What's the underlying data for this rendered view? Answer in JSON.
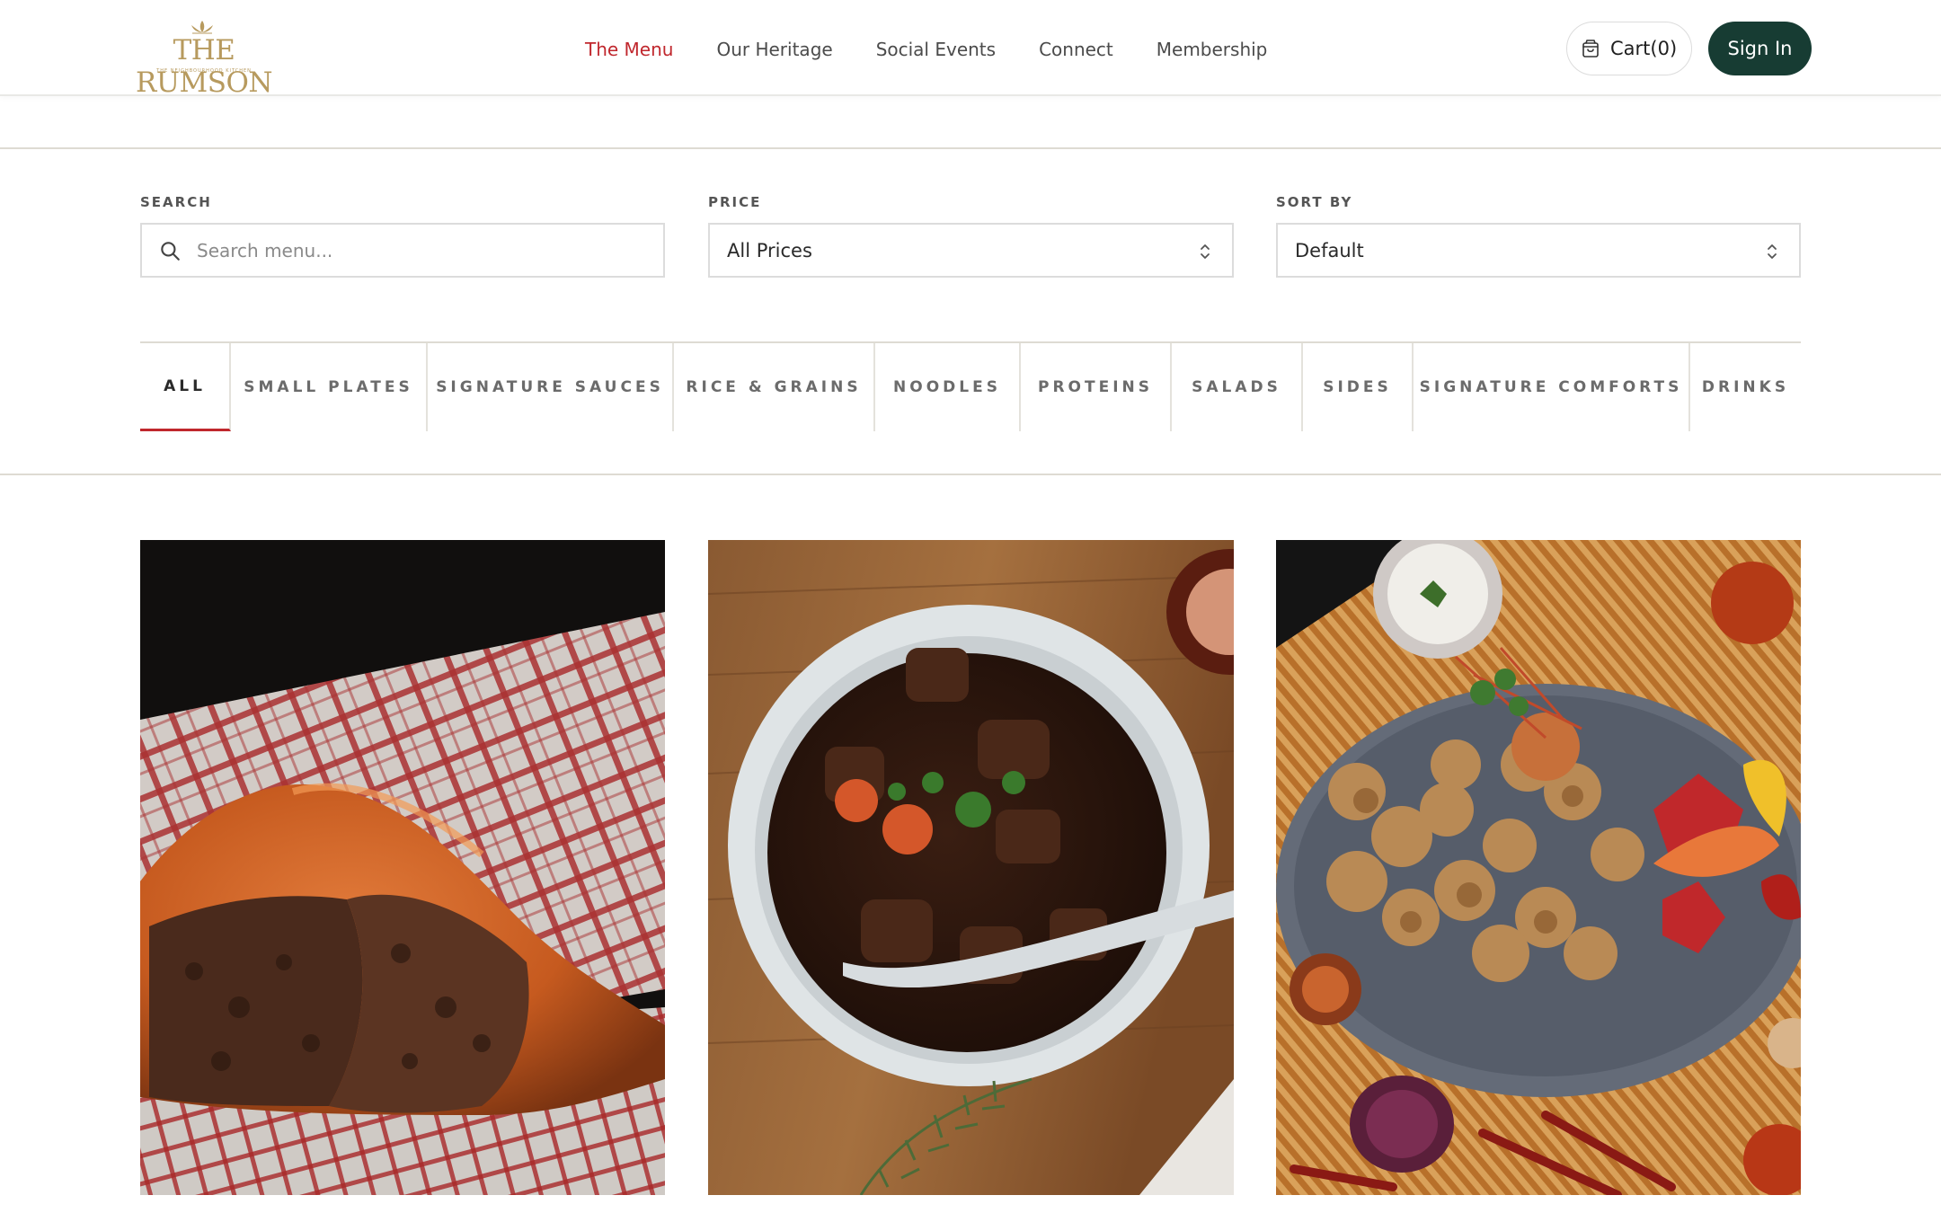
{
  "brand": {
    "name": "THE RUMSON",
    "tagline": "THE NEIGHBOURHOOD KITCHEN",
    "color": "#b79a5e"
  },
  "nav": {
    "items": [
      "The Menu",
      "Our Heritage",
      "Social Events",
      "Connect",
      "Membership"
    ],
    "active_index": 0,
    "active_color": "#c0272d"
  },
  "header": {
    "cart_label": "Cart(0)",
    "cart_icon": "shopping-bag-icon",
    "signin_label": "Sign In",
    "signin_bg": "#173c33"
  },
  "filters": {
    "search": {
      "label": "SEARCH",
      "placeholder": "Search menu...",
      "value": "",
      "icon": "search-icon"
    },
    "price": {
      "label": "PRICE",
      "selected": "All Prices",
      "icon": "chevron-up-down-icon"
    },
    "sort": {
      "label": "SORT BY",
      "selected": "Default",
      "icon": "chevron-up-down-icon"
    }
  },
  "categories": {
    "tabs": [
      "ALL",
      "SMALL PLATES",
      "SIGNATURE SAUCES",
      "RICE & GRAINS",
      "NOODLES",
      "PROTEINS",
      "SALADS",
      "SIDES",
      "SIGNATURE COMFORTS",
      "DRINKS"
    ],
    "active_index": 0,
    "accent": "#c0272d"
  },
  "menu_items": [
    {
      "image": "meat-pie-photo"
    },
    {
      "image": "beef-stew-photo"
    },
    {
      "image": "chicken-skewers-photo"
    }
  ]
}
